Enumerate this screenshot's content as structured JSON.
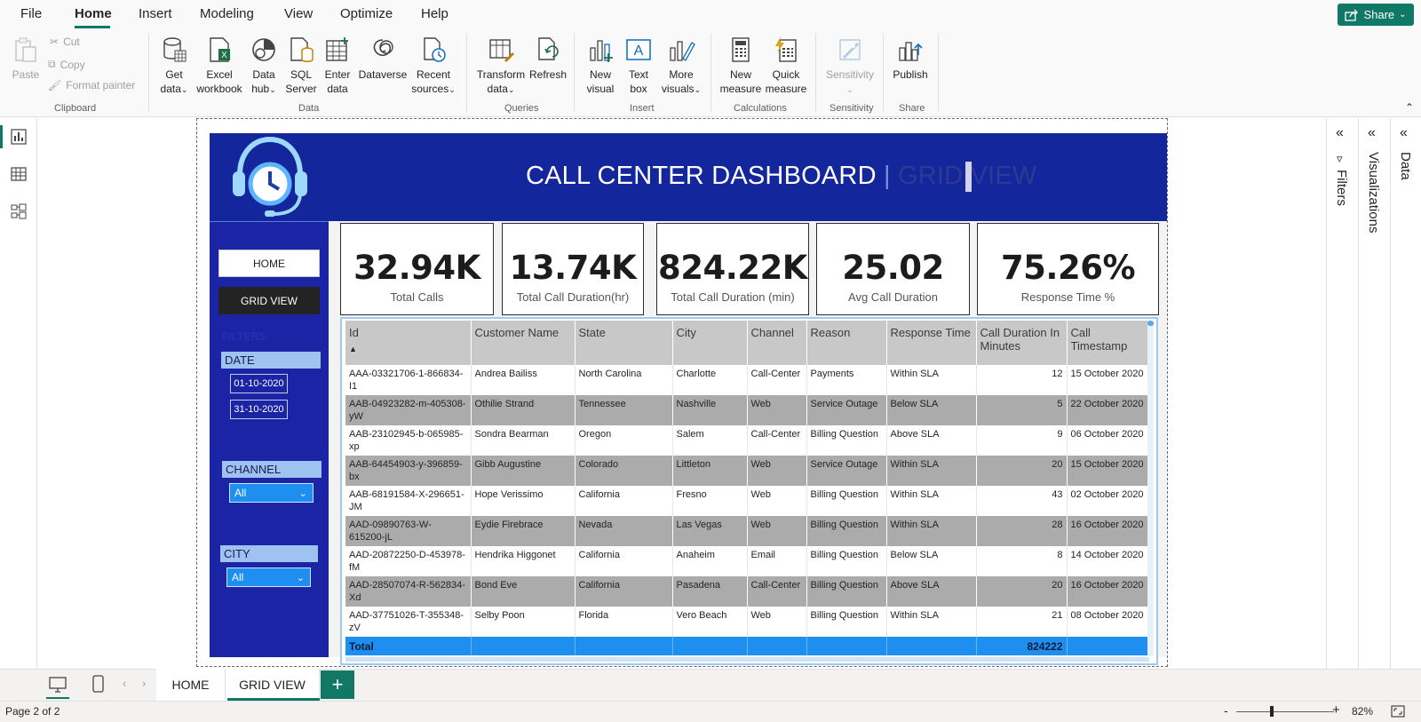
{
  "menu": {
    "file": "File",
    "home": "Home",
    "insert": "Insert",
    "modeling": "Modeling",
    "view": "View",
    "optimize": "Optimize",
    "help": "Help",
    "share": "Share"
  },
  "ribbon": {
    "paste": "Paste",
    "cut": "Cut",
    "copy": "Copy",
    "format_painter": "Format painter",
    "clipboard": "Clipboard",
    "get_data": [
      "Get",
      "data"
    ],
    "excel": [
      "Excel",
      "workbook"
    ],
    "data_hub": [
      "Data",
      "hub"
    ],
    "sql": [
      "SQL",
      "Server"
    ],
    "enter_data": [
      "Enter",
      "data"
    ],
    "dataverse": "Dataverse",
    "recent": [
      "Recent",
      "sources"
    ],
    "data_group": "Data",
    "transform": [
      "Transform",
      "data"
    ],
    "refresh": "Refresh",
    "queries": "Queries",
    "new_visual": [
      "New",
      "visual"
    ],
    "text_box": [
      "Text",
      "box"
    ],
    "more_visuals": [
      "More",
      "visuals"
    ],
    "insert_group": "Insert",
    "new_measure": [
      "New",
      "measure"
    ],
    "quick_measure": [
      "Quick",
      "measure"
    ],
    "calculations": "Calculations",
    "sensitivity": "Sensitivity",
    "sensitivity_group": "Sensitivity",
    "publish": "Publish",
    "share_group": "Share"
  },
  "report": {
    "title": "CALL CENTER DASHBOARD",
    "separator": "|",
    "subtitle": "GRID VIEW",
    "nav_home": "HOME",
    "nav_grid": "GRID VIEW",
    "filters": "FILTERS",
    "date_label": "DATE",
    "date_from": "01-10-2020",
    "date_to": "31-10-2020",
    "channel_label": "CHANNEL",
    "channel_value": "All",
    "city_label": "CITY",
    "city_value": "All"
  },
  "kpis": [
    {
      "value": "32.94K",
      "label": "Total Calls"
    },
    {
      "value": "13.74K",
      "label": "Total Call Duration(hr)"
    },
    {
      "value": "824.22K",
      "label": "Total Call Duration (min)"
    },
    {
      "value": "25.02",
      "label": "Avg Call Duration"
    },
    {
      "value": "75.26%",
      "label": "Response Time %"
    }
  ],
  "table": {
    "headers": [
      "Id",
      "Customer Name",
      "State",
      "City",
      "Channel",
      "Reason",
      "Response Time",
      "Call Duration In Minutes",
      "Call Timestamp"
    ],
    "rows": [
      [
        "AAA-03321706-1-866834-I1",
        "Andrea Bailiss",
        "North Carolina",
        "Charlotte",
        "Call-Center",
        "Payments",
        "Within SLA",
        "12",
        "15 October 2020"
      ],
      [
        "AAB-04923282-m-405308-yW",
        "Othilie Strand",
        "Tennessee",
        "Nashville",
        "Web",
        "Service Outage",
        "Below SLA",
        "5",
        "22 October 2020"
      ],
      [
        "AAB-23102945-b-065985-xp",
        "Sondra Bearman",
        "Oregon",
        "Salem",
        "Call-Center",
        "Billing Question",
        "Above SLA",
        "9",
        "06 October 2020"
      ],
      [
        "AAB-64454903-y-396859-bx",
        "Gibb Augustine",
        "Colorado",
        "Littleton",
        "Web",
        "Service Outage",
        "Within SLA",
        "20",
        "15 October 2020"
      ],
      [
        "AAB-68191584-X-296651-JM",
        "Hope Verissimo",
        "California",
        "Fresno",
        "Web",
        "Billing Question",
        "Within SLA",
        "43",
        "02 October 2020"
      ],
      [
        "AAD-09890763-W-615200-jL",
        "Eydie Firebrace",
        "Nevada",
        "Las Vegas",
        "Web",
        "Billing Question",
        "Within SLA",
        "28",
        "16 October 2020"
      ],
      [
        "AAD-20872250-D-453978-fM",
        "Hendrika Higgonet",
        "California",
        "Anaheim",
        "Email",
        "Billing Question",
        "Below SLA",
        "8",
        "14 October 2020"
      ],
      [
        "AAD-28507074-R-562834-Xd",
        "Bond Eve",
        "California",
        "Pasadena",
        "Call-Center",
        "Billing Question",
        "Above SLA",
        "20",
        "16 October 2020"
      ],
      [
        "AAD-37751026-T-355348-zV",
        "Selby Poon",
        "Florida",
        "Vero Beach",
        "Web",
        "Billing Question",
        "Within SLA",
        "21",
        "08 October 2020"
      ]
    ],
    "total_label": "Total",
    "total_value": "824222"
  },
  "panes": {
    "filters": "Filters",
    "visualizations": "Visualizations",
    "data": "Data"
  },
  "tabs": {
    "home": "HOME",
    "grid": "GRID VIEW",
    "add": "+"
  },
  "status": {
    "page": "Page 2 of 2",
    "zoom": "82%"
  }
}
